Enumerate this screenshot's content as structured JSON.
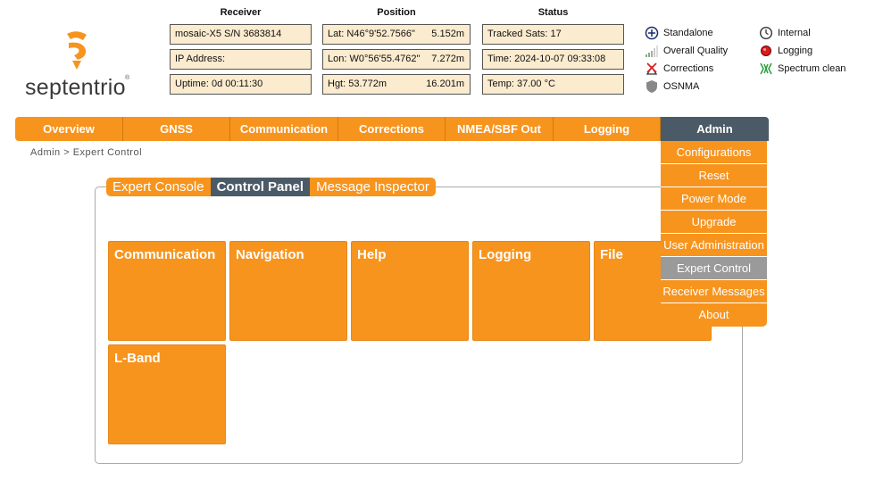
{
  "logo": {
    "text": "septentrio",
    "tm": "®"
  },
  "columns": {
    "receiver": {
      "title": "Receiver",
      "rows": [
        "mosaic-X5 S/N 3683814",
        "IP Address:",
        "Uptime: 0d 00:11:30"
      ]
    },
    "position": {
      "title": "Position",
      "rows": [
        {
          "label": "Lat:  N46°9'52.7566\"",
          "value": "5.152m"
        },
        {
          "label": "Lon: W0°56'55.4762\"",
          "value": "7.272m"
        },
        {
          "label": "Hgt:  53.772m",
          "value": "16.201m"
        }
      ]
    },
    "status": {
      "title": "Status",
      "rows": [
        "Tracked Sats: 17",
        "Time: 2024-10-07 09:33:08",
        "Temp: 37.00 °C"
      ]
    }
  },
  "legend": {
    "standalone": "Standalone",
    "overall_quality": "Overall Quality",
    "corrections": "Corrections",
    "osnma": "OSNMA",
    "internal": "Internal",
    "logging": "Logging",
    "spectrum": "Spectrum clean"
  },
  "nav": {
    "overview": "Overview",
    "gnss": "GNSS",
    "communication": "Communication",
    "corrections": "Corrections",
    "nmea": "NMEA/SBF Out",
    "logging": "Logging",
    "admin": "Admin"
  },
  "breadcrumb": "Admin > Expert Control",
  "tabs": {
    "console": "Expert Console",
    "control_panel": "Control Panel",
    "inspector": "Message Inspector"
  },
  "tiles": {
    "communication": "Communication",
    "navigation": "Navigation",
    "help": "Help",
    "logging": "Logging",
    "file": "File",
    "lband": "L-Band"
  },
  "admin_menu": {
    "configurations": "Configurations",
    "reset": "Reset",
    "power_mode": "Power Mode",
    "upgrade": "Upgrade",
    "user_admin": "User Administration",
    "expert_control": "Expert Control",
    "receiver_messages": "Receiver Messages",
    "about": "About"
  },
  "colors": {
    "accent": "#f7941e",
    "active": "#4b5a67",
    "info_bg": "#fbebcf",
    "selected": "#9a9a9a"
  }
}
